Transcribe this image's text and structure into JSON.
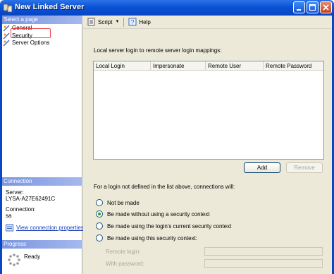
{
  "window": {
    "title": "New Linked Server"
  },
  "left_pane": {
    "select_page_header": "Select a page",
    "pages": [
      {
        "label": "General",
        "selected": false
      },
      {
        "label": "Security",
        "selected": true
      },
      {
        "label": "Server Options",
        "selected": false
      }
    ],
    "connection_header": "Connection",
    "server_label": "Server:",
    "server_value": "LYSA-A27E62491C",
    "connection_label": "Connection:",
    "connection_value": "sa",
    "view_connection_properties": "View connection properties",
    "progress_header": "Progress",
    "progress_status": "Ready"
  },
  "toolbar": {
    "script_label": "Script",
    "help_label": "Help"
  },
  "main": {
    "mapping_label": "Local server login to remote server login mappings:",
    "columns": [
      "Local Login",
      "Impersonate",
      "Remote User",
      "Remote Password"
    ],
    "add_button": "Add",
    "remove_button": "Remove",
    "policy_label": "For a login not defined in the list above, connections will:",
    "options": [
      {
        "label": "Not be made",
        "selected": false
      },
      {
        "label": "Be made without using a security context",
        "selected": true
      },
      {
        "label": "Be made using the login's current security context",
        "selected": false
      },
      {
        "label": "Be made using this security context:",
        "selected": false
      }
    ],
    "remote_login_label": "Remote login:",
    "remote_login_value": "",
    "password_label": "With password:",
    "password_value": ""
  },
  "colors": {
    "titlebar": "#0b52d6",
    "section_header": "#7a96df",
    "selection_outline": "#e4434a",
    "link": "#1a3eb8"
  }
}
